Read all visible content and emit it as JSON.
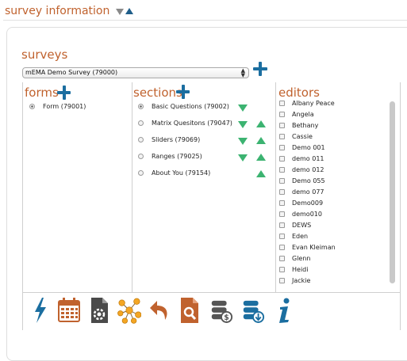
{
  "header": {
    "title": "survey information",
    "collapse_icon": "triangle-down-icon",
    "expand_icon": "triangle-up-icon"
  },
  "surveys": {
    "label": "surveys",
    "selected": "mEMA Demo Survey (79000)",
    "add_icon": "plus-icon"
  },
  "forms": {
    "label": "forms",
    "items": [
      {
        "label": "Form (79001)",
        "selected": true
      }
    ]
  },
  "sections": {
    "label": "sections",
    "items": [
      {
        "label": "Basic Questions (79002)",
        "selected": true,
        "down": true,
        "up": false
      },
      {
        "label": "Matrix Quesitons (79047)",
        "selected": false,
        "down": true,
        "up": true
      },
      {
        "label": "Sliders (79069)",
        "selected": false,
        "down": true,
        "up": true
      },
      {
        "label": "Ranges (79025)",
        "selected": false,
        "down": true,
        "up": true
      },
      {
        "label": "About You (79154)",
        "selected": false,
        "down": false,
        "up": true
      }
    ]
  },
  "editors": {
    "label": "editors",
    "items": [
      "Albany Peace",
      "Angela",
      "Bethany",
      "Cassie",
      "Demo 001",
      "demo 011",
      "demo 012",
      "Demo 055",
      "demo 077",
      "Demo009",
      "demo010",
      "DEWS",
      "Eden",
      "Evan Kleiman",
      "Glenn",
      "Heidi",
      "Jackie"
    ]
  },
  "toolbar": {
    "icons": [
      "lightning-icon",
      "calendar-icon",
      "document-gear-icon",
      "network-icon",
      "undo-arrow-icon",
      "document-search-icon",
      "database-dollar-icon",
      "database-download-icon",
      "info-icon"
    ]
  },
  "colors": {
    "accent": "#c0622e",
    "brand_blue": "#1b6ea0",
    "arrow_green": "#3cb371"
  }
}
